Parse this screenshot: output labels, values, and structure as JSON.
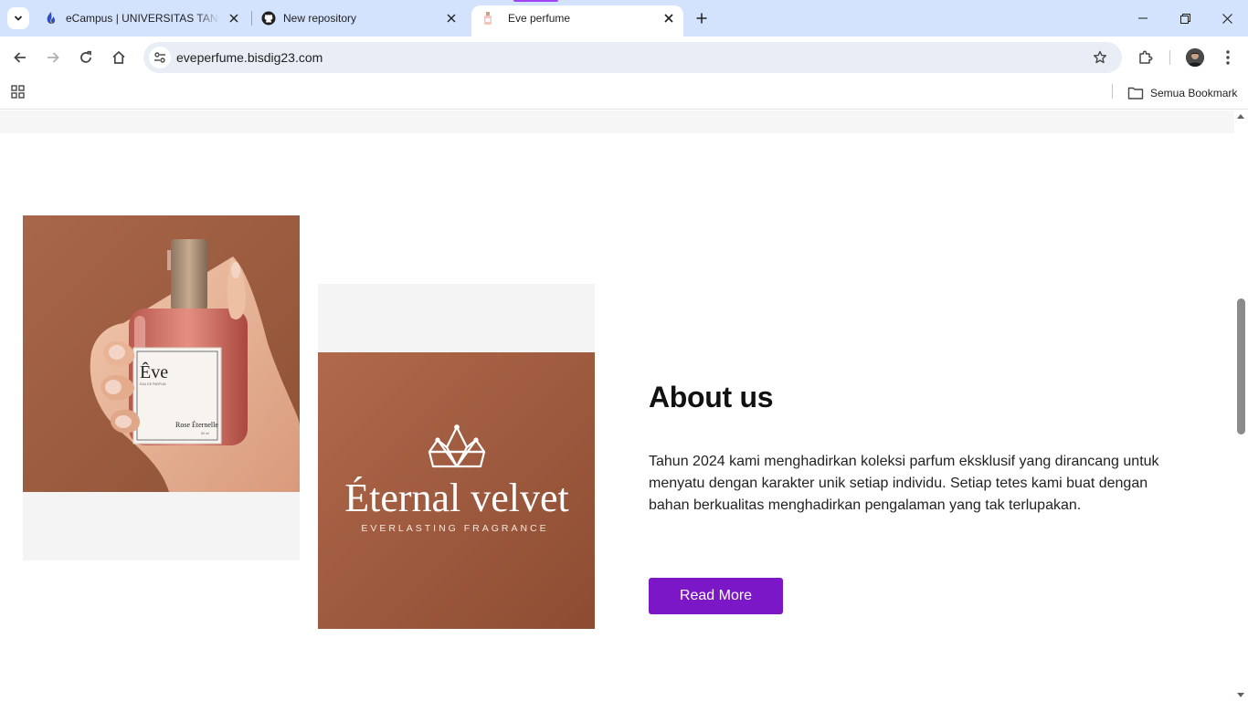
{
  "browser": {
    "tabs": [
      {
        "title": "eCampus | UNIVERSITAS TANGERANG",
        "favicon": "ecampus-flame-icon",
        "active": false
      },
      {
        "title": "New repository",
        "favicon": "github-icon",
        "active": false
      },
      {
        "title": "Eve perfume",
        "favicon": "perfume-bottle-icon",
        "active": true
      }
    ],
    "url": "eveperfume.bisdig23.com",
    "all_bookmarks_label": "Semua Bookmark"
  },
  "page": {
    "product_image": {
      "brand": "Êve",
      "label": "Rose Éternelle"
    },
    "logo_image": {
      "brand": "Éternal velvet",
      "tagline": "EVERLASTING FRAGRANCE"
    },
    "about": {
      "heading": "About us",
      "body": "Tahun 2024 kami menghadirkan koleksi parfum eksklusif yang dirancang untuk menyatu dengan karakter unik setiap individu. Setiap tetes kami buat dengan bahan berkualitas menghadirkan pengalaman yang tak terlupakan.",
      "button_label": "Read More"
    }
  },
  "colors": {
    "accent_button": "#7b17c6",
    "tab_strip": "#d3e3fd",
    "image_brown": "#a3603f"
  }
}
